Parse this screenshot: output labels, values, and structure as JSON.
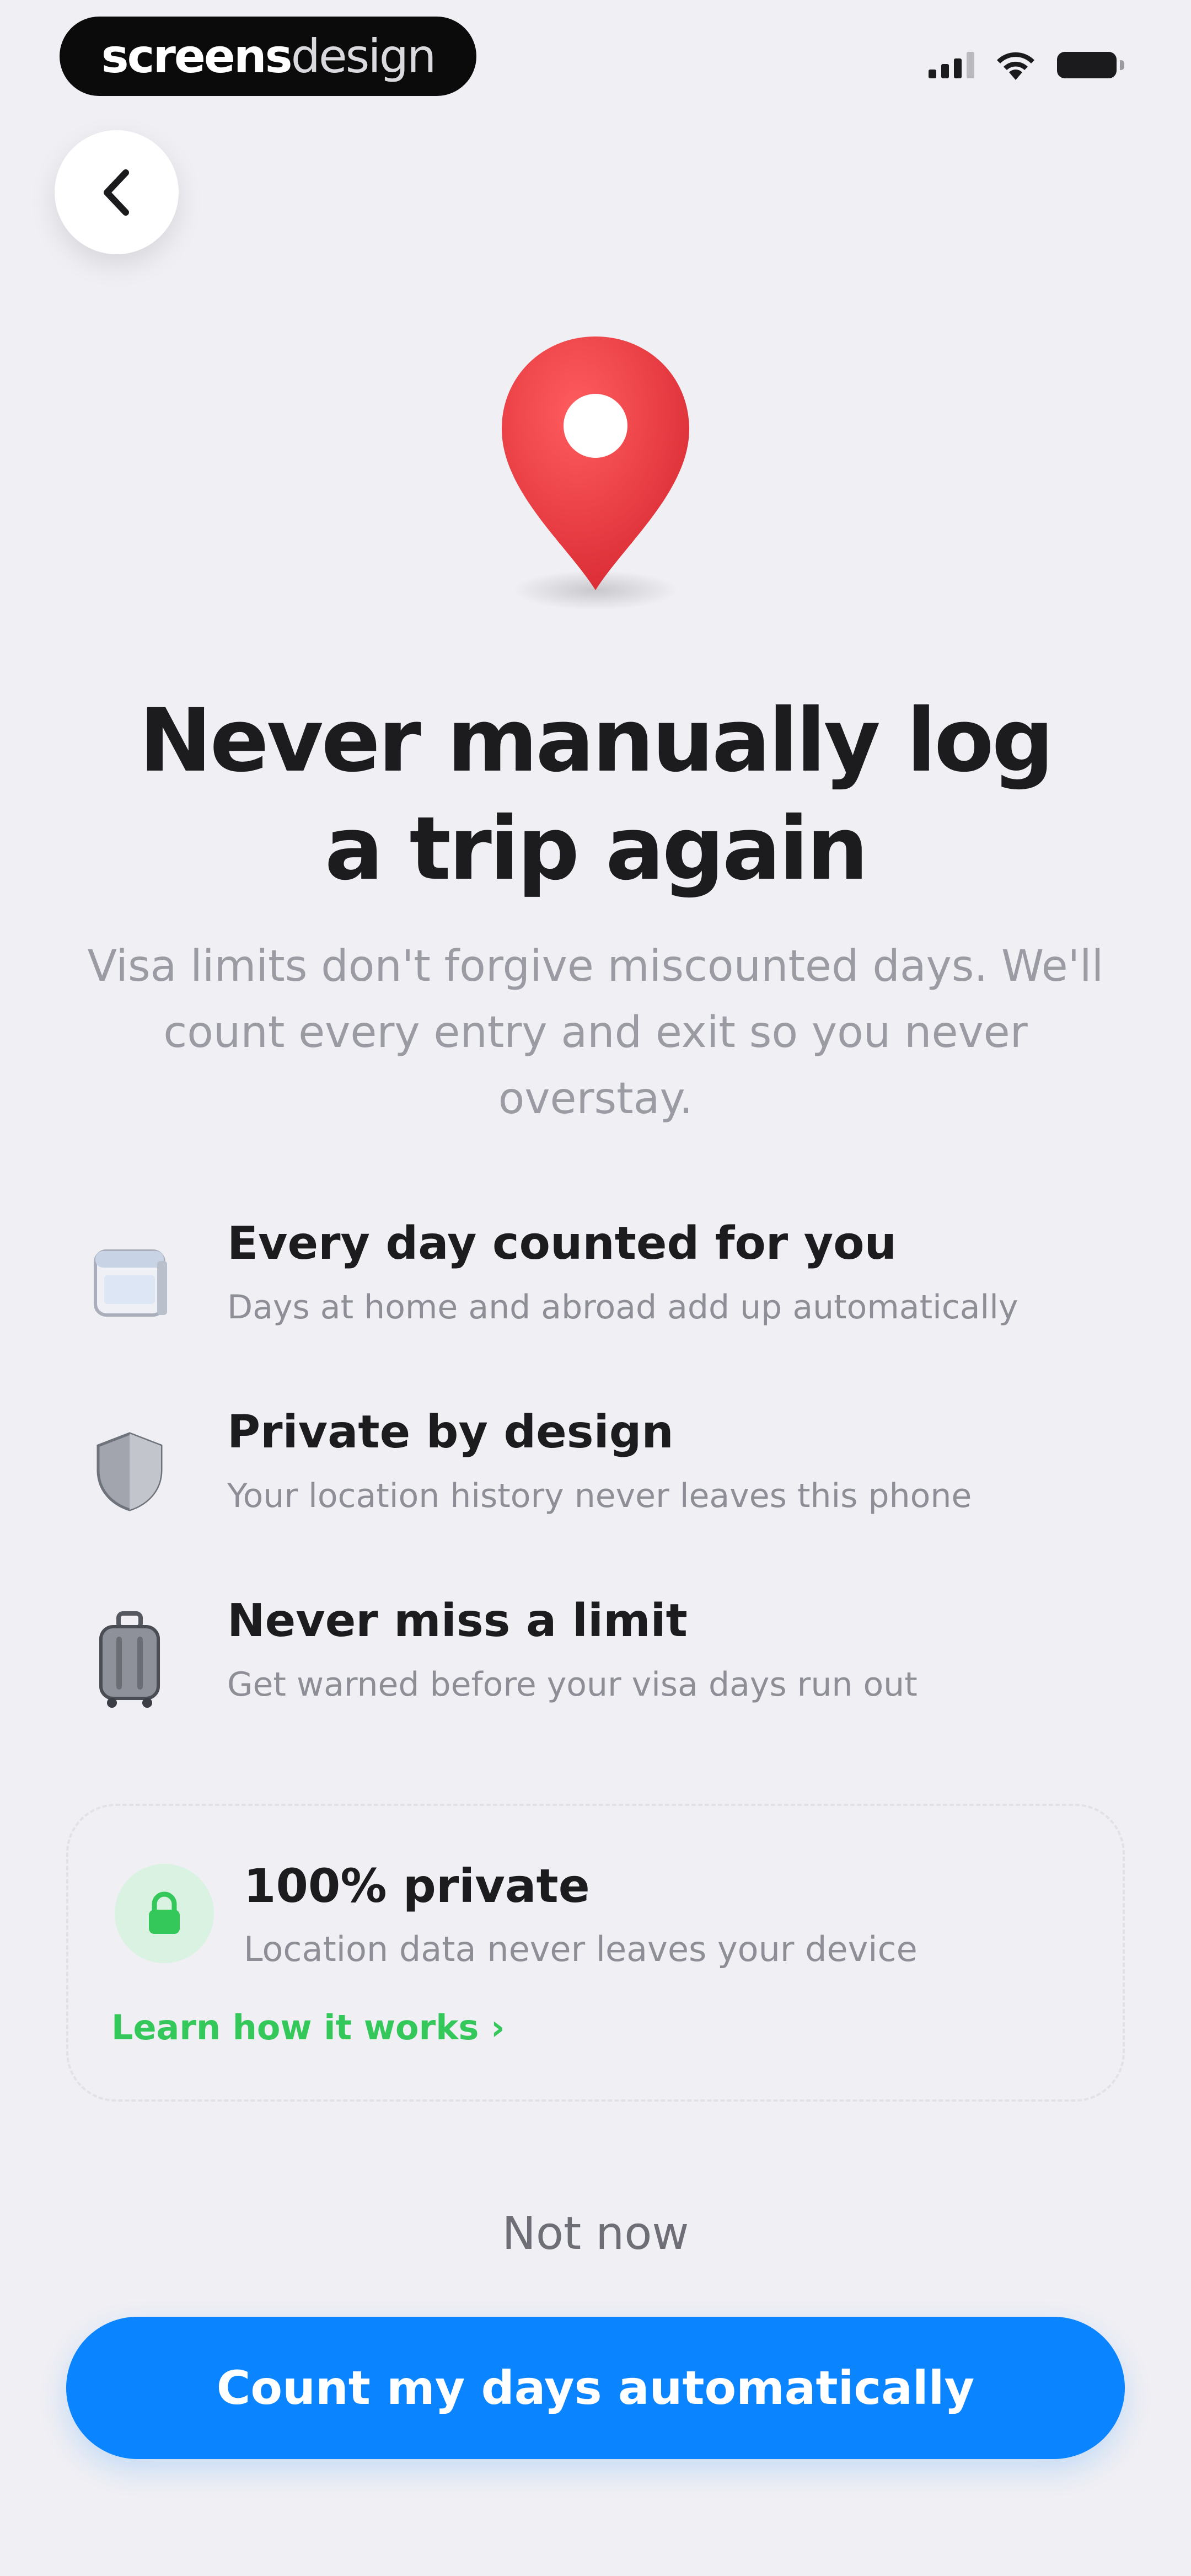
{
  "watermark": {
    "bold": "screens",
    "light": "design"
  },
  "header": {
    "back_icon": "chevron-left-icon"
  },
  "hero": {
    "icon": "map-pin-icon",
    "pin_color": "#e63a3f",
    "title_line1": "Never manually log",
    "title_line2": "a trip again",
    "subtitle_line1": "Visa limits don't forgive miscounted days. We'll",
    "subtitle_line2": "count every entry and exit so you never",
    "subtitle_line3": "overstay."
  },
  "features": [
    {
      "icon": "calendar-icon",
      "title": "Every day counted for you",
      "description": "Days at home and abroad add up automatically"
    },
    {
      "icon": "shield-icon",
      "title": "Private by design",
      "description": "Your location history never leaves this phone"
    },
    {
      "icon": "suitcase-icon",
      "title": "Never miss a limit",
      "description": "Get warned before your visa days run out"
    }
  ],
  "privacy_card": {
    "icon": "lock-icon",
    "title": "100% private",
    "description": "Location data never leaves your device",
    "link": "Learn how it works",
    "accent_color": "#34c759"
  },
  "actions": {
    "secondary": "Not now",
    "primary": "Count my days automatically",
    "primary_color": "#0a84ff"
  }
}
